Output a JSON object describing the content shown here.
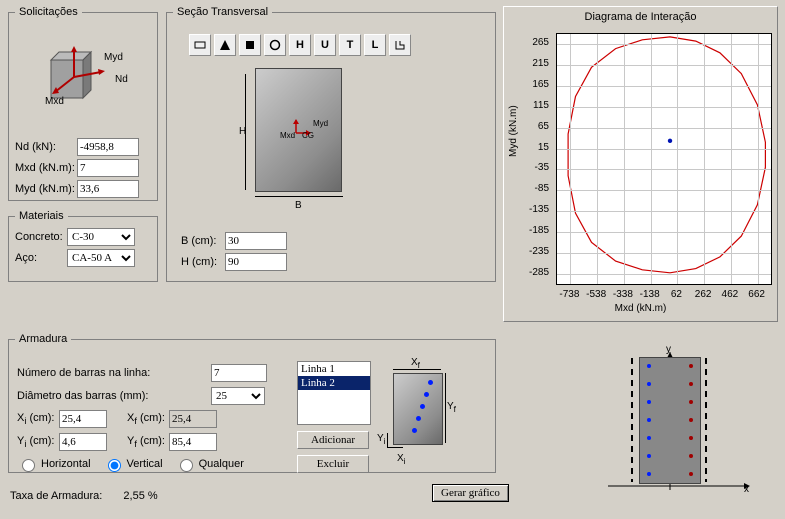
{
  "solicitacoes": {
    "legend": "Solicitações",
    "nd_label": "Nd (kN):",
    "nd_value": "-4958,8",
    "mxd_label": "Mxd (kN.m):",
    "mxd_value": "7",
    "myd_label": "Myd (kN.m):",
    "myd_value": "33,6",
    "cube_myd": "Myd",
    "cube_nd": "Nd",
    "cube_mxd": "Mxd"
  },
  "materiais": {
    "legend": "Materiais",
    "concreto_label": "Concreto:",
    "concreto_value": "C-30",
    "concreto_options": [
      "C-30"
    ],
    "aco_label": "Aço:",
    "aco_value": "CA-50 A",
    "aco_options": [
      "CA-50 A"
    ]
  },
  "secao": {
    "legend": "Seção Transversal",
    "b_label": "B (cm):",
    "b_value": "30",
    "h_label": "H (cm):",
    "h_value": "90",
    "sketch": {
      "H": "H",
      "B": "B",
      "Myd": "Myd",
      "Mxd": "Mxd",
      "CG": "CG"
    },
    "shapes": [
      "rect-outline",
      "triangle",
      "square-solid",
      "circle",
      "H",
      "U",
      "T",
      "L",
      "angle"
    ]
  },
  "armadura": {
    "legend": "Armadura",
    "numero_label": "Número de barras na linha:",
    "numero_value": "7",
    "diametro_label": "Diâmetro das barras (mm):",
    "diametro_value": "25",
    "diametro_options": [
      "25"
    ],
    "xi_label": "X",
    "xi_unit": " (cm):",
    "xi_value": "25,4",
    "xf_label": "X",
    "xf_unit": " (cm):",
    "xf_value": "25,4",
    "yi_label": "Y",
    "yi_unit": " (cm):",
    "yi_value": "4,6",
    "yf_label": "Y",
    "yf_unit": " (cm):",
    "yf_value": "85,4",
    "sub_i": "i",
    "sub_f": "f",
    "radio_horizontal": "Horizontal",
    "radio_vertical": "Vertical",
    "radio_qualquer": "Qualquer",
    "radio_selected": "Vertical",
    "list": [
      "Linha 1",
      "Linha 2"
    ],
    "list_selected": 1,
    "btn_adicionar": "Adicionar",
    "btn_excluir": "Excluir",
    "sketch": {
      "Xf": "X",
      "Yf": "Y",
      "Xi": "X",
      "Yi": "Y"
    }
  },
  "footer": {
    "taxa_label": "Taxa de Armadura:",
    "taxa_value": "2,55 %",
    "gerar_btn": "Gerar gráfico"
  },
  "chart": {
    "title": "Diagrama de Interação",
    "ylabel": "Myd (kN.m)",
    "xlabel": "Mxd (kN.m)"
  },
  "rebar": {
    "axis_x": "x",
    "axis_y": "y"
  },
  "chart_data": {
    "type": "line",
    "title": "Diagrama de Interação",
    "xlabel": "Mxd (kN.m)",
    "ylabel": "Myd (kN.m)",
    "xlim": [
      -838,
      762
    ],
    "ylim": [
      -310,
      290
    ],
    "xticks": [
      -738,
      -538,
      -338,
      -138,
      62,
      262,
      462,
      662
    ],
    "yticks": [
      -285,
      -235,
      -185,
      -135,
      -85,
      -35,
      15,
      65,
      115,
      165,
      215,
      265
    ],
    "point": {
      "mxd": 7,
      "myd": 33.6
    },
    "curve": [
      {
        "x": 7,
        "y": 283
      },
      {
        "x": 200,
        "y": 273
      },
      {
        "x": 380,
        "y": 245
      },
      {
        "x": 540,
        "y": 195
      },
      {
        "x": 660,
        "y": 120
      },
      {
        "x": 720,
        "y": 30
      },
      {
        "x": 720,
        "y": -30
      },
      {
        "x": 660,
        "y": -120
      },
      {
        "x": 540,
        "y": -195
      },
      {
        "x": 380,
        "y": -245
      },
      {
        "x": 200,
        "y": -273
      },
      {
        "x": 7,
        "y": -283
      },
      {
        "x": -200,
        "y": -276
      },
      {
        "x": -400,
        "y": -255
      },
      {
        "x": -580,
        "y": -210
      },
      {
        "x": -700,
        "y": -140
      },
      {
        "x": -755,
        "y": -50
      },
      {
        "x": -755,
        "y": 50
      },
      {
        "x": -700,
        "y": 140
      },
      {
        "x": -580,
        "y": 210
      },
      {
        "x": -400,
        "y": 255
      },
      {
        "x": -200,
        "y": 276
      },
      {
        "x": 7,
        "y": 283
      }
    ]
  }
}
